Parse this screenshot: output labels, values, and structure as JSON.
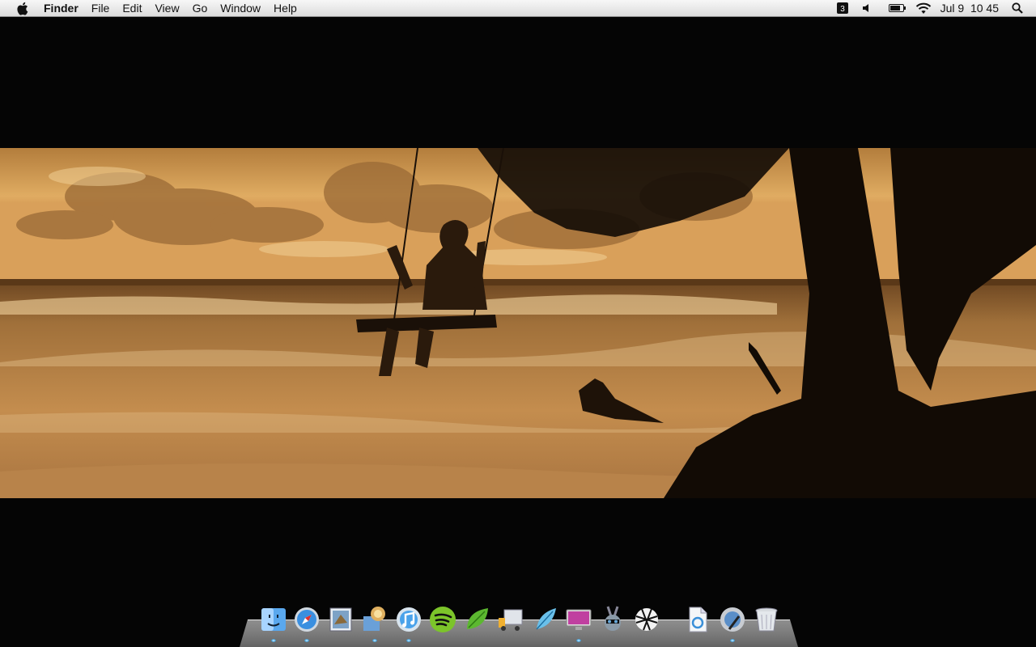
{
  "menubar": {
    "app_name": "Finder",
    "items": [
      "File",
      "Edit",
      "View",
      "Go",
      "Window",
      "Help"
    ],
    "clock": "Jul 9  10 45",
    "status_icons": [
      "input-source-icon",
      "volume-icon",
      "battery-icon",
      "wifi-icon",
      "spotlight-search-icon"
    ]
  },
  "wallpaper": {
    "subject": "sepia beach with woman on swing"
  },
  "dock": {
    "apps": [
      "finder",
      "safari",
      "mail",
      "app-store",
      "itunes",
      "spotify",
      "coda",
      "transmit",
      "feather",
      "imac-display",
      "cyberduck",
      "bug-ball",
      "text-file",
      "disk-utility",
      "trash"
    ]
  },
  "colors": {
    "menubar": "#e6e6e6",
    "desktop": "#050505",
    "sepia_sky": "#d9a05c"
  }
}
